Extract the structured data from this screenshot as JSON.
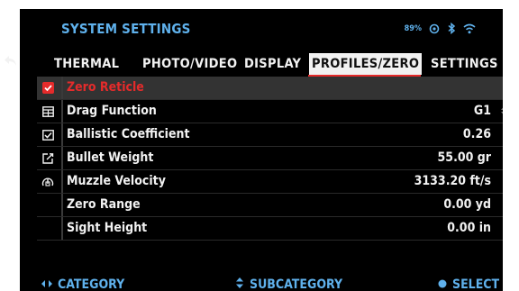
{
  "header": {
    "title": "SYSTEM SETTINGS",
    "battery": "89%",
    "icons": [
      "gps-icon",
      "bluetooth-icon",
      "wifi-icon"
    ]
  },
  "tabs": [
    {
      "label": "THERMAL",
      "active": false
    },
    {
      "label": "PHOTO/VIDEO",
      "active": false
    },
    {
      "label": "DISPLAY",
      "active": false
    },
    {
      "label": "PROFILES/ZERO",
      "active": true
    },
    {
      "label": "SETTINGS",
      "active": false
    }
  ],
  "rows": [
    {
      "label": "Zero Reticle",
      "value": "",
      "icon": "checkbox-checked-icon",
      "end": "chevron-right-icon"
    },
    {
      "label": "Drag Function",
      "value": "G1",
      "icon": "table-icon",
      "end": "up-down-icon"
    },
    {
      "label": "Ballistic Coefficient",
      "value": "0.26",
      "icon": "edit-box-icon",
      "end": "chevron-right-icon"
    },
    {
      "label": "Bullet Weight",
      "value": "55.00 gr",
      "icon": "external-link-icon",
      "end": "chevron-right-icon"
    },
    {
      "label": "Muzzle Velocity",
      "value": "3133.20 ft/s",
      "icon": "speedometer-icon",
      "end": "chevron-right-icon"
    },
    {
      "label": "Zero Range",
      "value": "0.00 yd",
      "icon": "",
      "end": "chevron-right-icon"
    },
    {
      "label": "Sight Height",
      "value": "0.00 in",
      "icon": "",
      "end": "chevron-right-icon"
    }
  ],
  "footer": {
    "category": "CATEGORY",
    "subcategory": "SUBCATEGORY",
    "select": "SELECT"
  },
  "colors": {
    "accent_blue": "#5fb1ec",
    "accent_red": "#e52b2b",
    "background": "#000000",
    "text": "#f2f2f2"
  }
}
